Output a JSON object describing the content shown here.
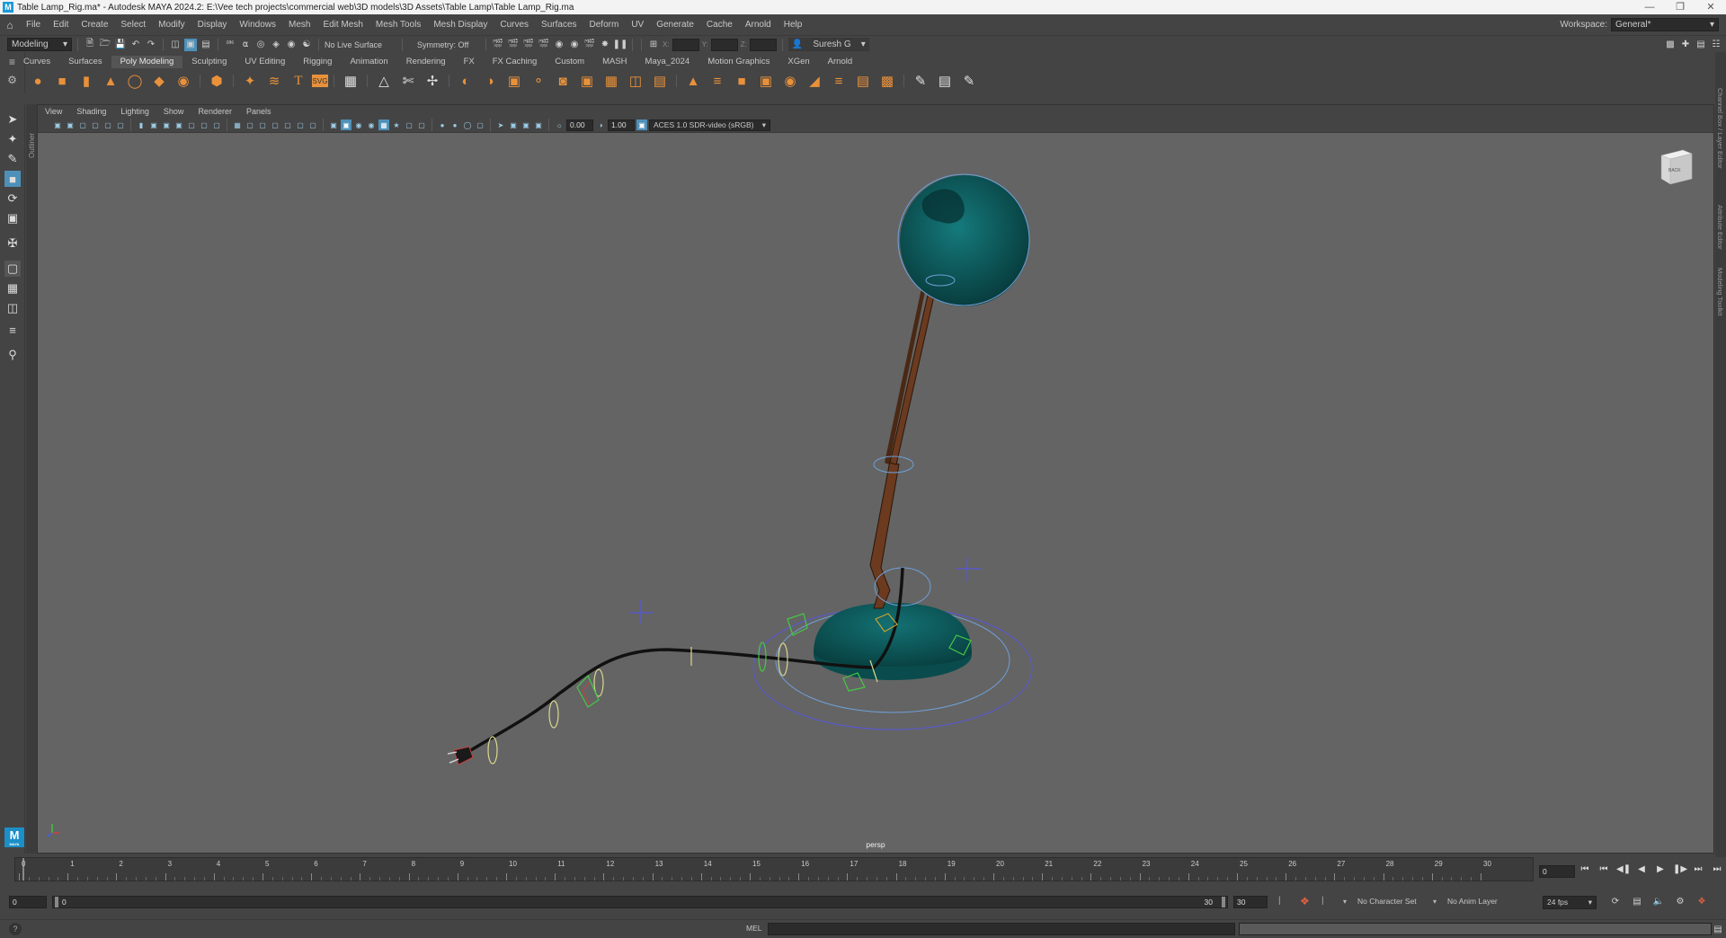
{
  "window": {
    "title": "Table Lamp_Rig.ma* - Autodesk MAYA 2024.2: E:\\Vee tech projects\\commercial web\\3D models\\3D Assets\\Table Lamp\\Table Lamp_Rig.ma",
    "app_icon": "M"
  },
  "menubar": {
    "items": [
      "File",
      "Edit",
      "Create",
      "Select",
      "Modify",
      "Display",
      "Windows",
      "Mesh",
      "Edit Mesh",
      "Mesh Tools",
      "Mesh Display",
      "Curves",
      "Surfaces",
      "Deform",
      "UV",
      "Generate",
      "Cache",
      "Arnold",
      "Help"
    ],
    "workspace_label": "Workspace:",
    "workspace_value": "General*"
  },
  "statusline": {
    "menuset": "Modeling",
    "live_surface": "No Live Surface",
    "symmetry": "Symmetry: Off",
    "x_label": "X:",
    "y_label": "Y:",
    "z_label": "Z:",
    "user": "Suresh G"
  },
  "shelf": {
    "tabs": [
      "Curves",
      "Surfaces",
      "Poly Modeling",
      "Sculpting",
      "UV Editing",
      "Rigging",
      "Animation",
      "Rendering",
      "FX",
      "FX Caching",
      "Custom",
      "MASH",
      "Maya_2024",
      "Motion Graphics",
      "XGen",
      "Arnold"
    ],
    "active_tab": "Poly Modeling"
  },
  "viewport": {
    "menu": [
      "View",
      "Shading",
      "Lighting",
      "Show",
      "Renderer",
      "Panels"
    ],
    "exposure": "0.00",
    "gamma": "1.00",
    "colorspace": "ACES 1.0 SDR-video (sRGB)",
    "camera": "persp",
    "viewcube_face": "BACK",
    "outliner_label": "Outliner",
    "right_panel_labels": [
      "Channel Box / Layer Editor",
      "Attribute Editor",
      "Modeling Toolkit"
    ]
  },
  "timeline": {
    "ticks": [
      "0",
      "1",
      "2",
      "3",
      "4",
      "5",
      "6",
      "7",
      "8",
      "9",
      "10",
      "11",
      "12",
      "13",
      "14",
      "15",
      "16",
      "17",
      "18",
      "19",
      "20",
      "21",
      "22",
      "23",
      "24",
      "25",
      "26",
      "27",
      "28",
      "29",
      "30"
    ],
    "current_frame": "0"
  },
  "range": {
    "start": "0",
    "playback_start": "0",
    "playback_end": "30",
    "end": "30",
    "character_set": "No Character Set",
    "anim_layer": "No Anim Layer",
    "fps": "24 fps"
  },
  "cmdline": {
    "lang": "MEL"
  },
  "colors": {
    "lamp": "#0d5a5c",
    "stand": "#6b3a1f",
    "control_blue": "#5a5ac8",
    "control_green": "#46c846",
    "control_yellow": "#d8d890",
    "selected": "#4d90b8"
  }
}
